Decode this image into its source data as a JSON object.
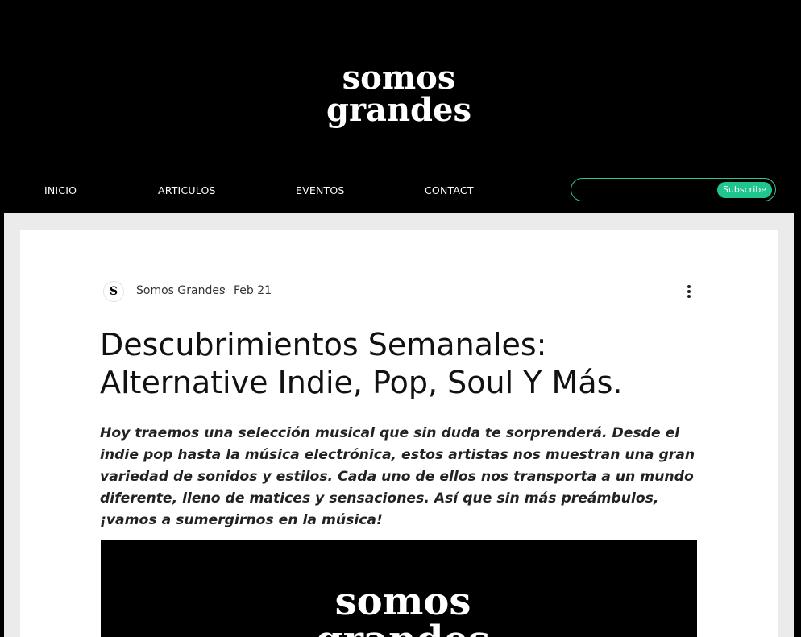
{
  "site": {
    "logo_text_line1": "somos",
    "logo_text_line2": "grandes",
    "logo_icon": "somos-grandes-logo"
  },
  "nav": {
    "items": [
      {
        "label": "INICIO"
      },
      {
        "label": "ARTICULOS"
      },
      {
        "label": "EVENTOS"
      },
      {
        "label": "CONTACT"
      }
    ]
  },
  "subscribe": {
    "input_value": "",
    "button_label": "Subscribe",
    "accent_color": "#1fc68d"
  },
  "post": {
    "author": "Somos Grandes",
    "separator": "·",
    "date": "Feb 21",
    "more_icon": "more-vertical-icon",
    "title": "Descubrimientos Semanales: Alternative Indie, Pop, Soul Y Más.",
    "intro": "Hoy traemos una selección musical que sin duda te sorprenderá. Desde el indie pop hasta la música electrónica, estos artistas nos muestran una gran variedad de sonidos y estilos. Cada uno de ellos nos transporta a un mundo diferente, lleno de matices y sensaciones. Así que sin más preámbulos, ¡vamos a sumergirnos en la música!",
    "avatar_glyph": "S"
  },
  "colors": {
    "background": "#000000",
    "card": "#ffffff",
    "content_bg": "#ebebeb"
  }
}
